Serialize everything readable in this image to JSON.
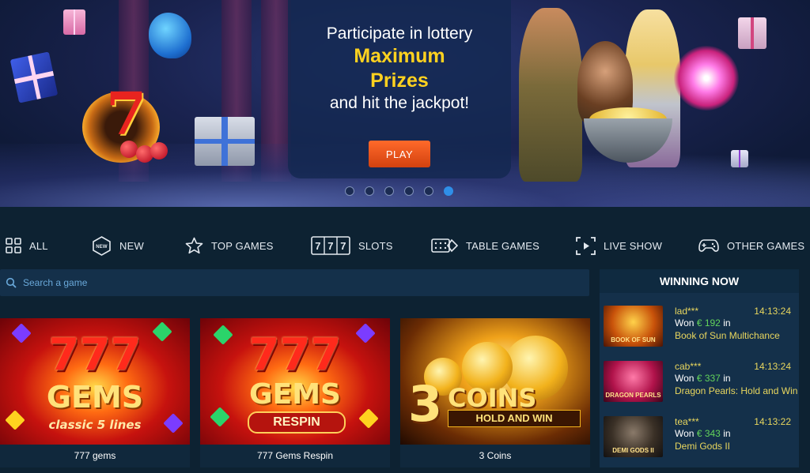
{
  "hero": {
    "line1": "Participate in lottery",
    "line2": "Maximum",
    "line3": "Prizes",
    "line4": "and hit the jackpot!",
    "play_label": "PLAY",
    "slides": 6,
    "active_slide": 6
  },
  "categories": [
    {
      "label": "ALL",
      "icon": "grid-icon"
    },
    {
      "label": "NEW",
      "icon": "new-badge-icon"
    },
    {
      "label": "TOP GAMES",
      "icon": "star-icon"
    },
    {
      "label": "SLOTS",
      "icon": "slot-777-icon"
    },
    {
      "label": "TABLE GAMES",
      "icon": "cards-dice-icon"
    },
    {
      "label": "LIVE SHOW",
      "icon": "live-play-icon"
    },
    {
      "label": "OTHER GAMES",
      "icon": "gamepad-icon"
    }
  ],
  "search": {
    "placeholder": "Search a game"
  },
  "games": [
    {
      "title": "777 gems",
      "art_main": "777",
      "art_sub": "GEMS",
      "art_tag": "classic 5 lines"
    },
    {
      "title": "777 Gems Respin",
      "art_main": "777",
      "art_sub": "GEMS",
      "art_tag": "RESPIN"
    },
    {
      "title": "3 Coins",
      "art_main": "3",
      "art_sub": "COINS",
      "art_tag": "HOLD AND WIN"
    }
  ],
  "winning_now": {
    "title": "WINNING NOW",
    "entries": [
      {
        "user": "lad***",
        "time": "14:13:24",
        "won_prefix": "Won",
        "amount": "€ 192",
        "in": "in",
        "game": "Book of Sun Multichance",
        "thumb_text": "BOOK OF SUN"
      },
      {
        "user": "cab***",
        "time": "14:13:24",
        "won_prefix": "Won",
        "amount": "€ 337",
        "in": "in",
        "game": "Dragon Pearls: Hold and Win",
        "thumb_text": "DRAGON PEARLS"
      },
      {
        "user": "tea***",
        "time": "14:13:22",
        "won_prefix": "Won",
        "amount": "€ 343",
        "in": "in",
        "game": "Demi Gods II",
        "thumb_text": "DEMI GODS II"
      }
    ]
  },
  "colors": {
    "background": "#0d2232",
    "accent_yellow": "#ffd21f",
    "play_orange": "#e4521a",
    "won_green": "#63d45a",
    "user_yellow": "#e8d65e",
    "dot_active": "#2f8fe8"
  }
}
